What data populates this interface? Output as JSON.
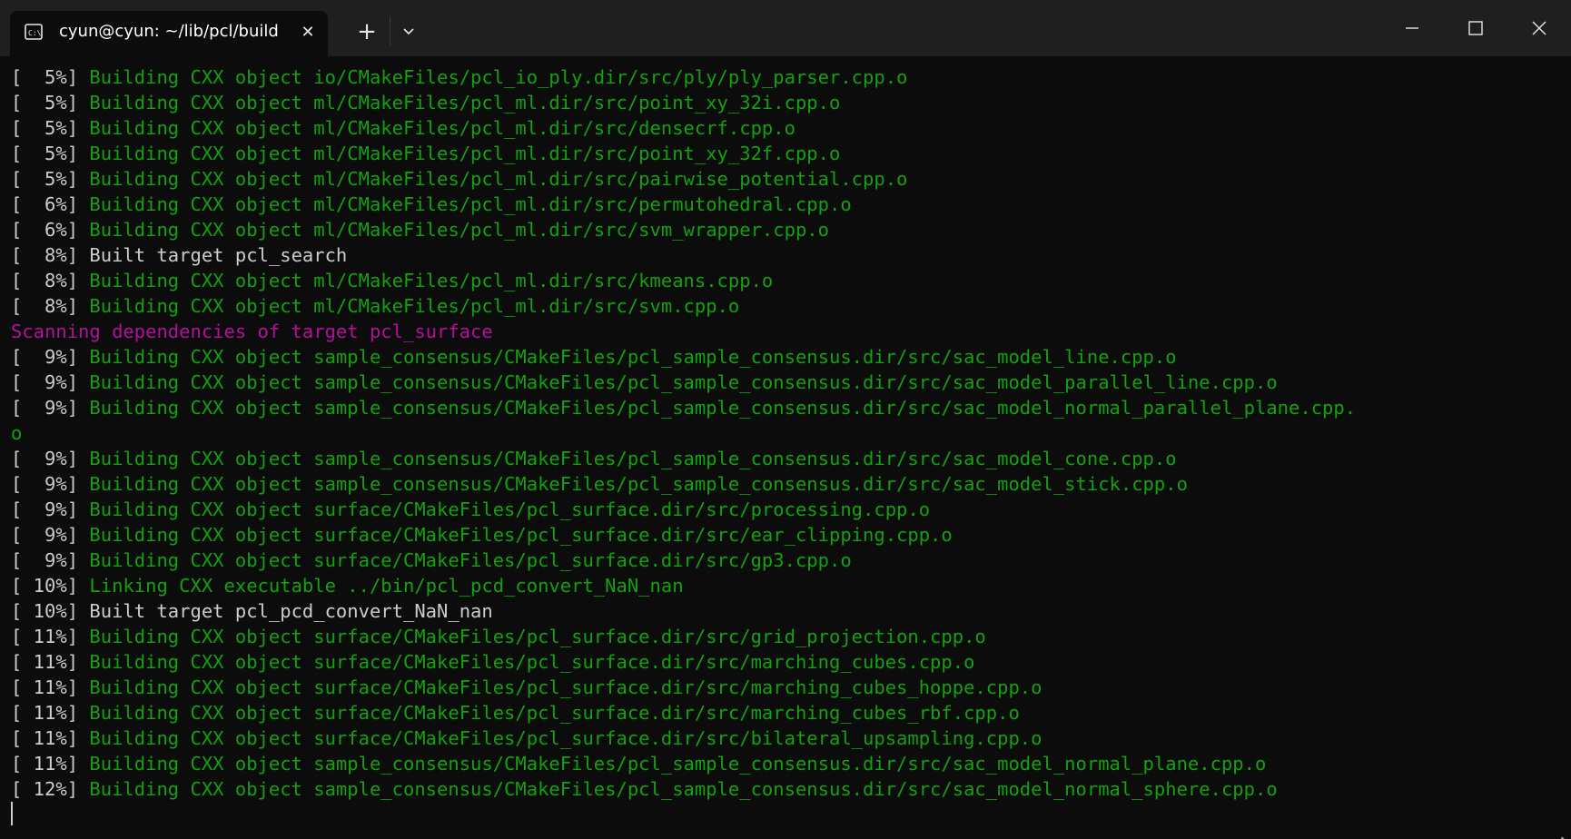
{
  "window": {
    "tab_title": "cyun@cyun: ~/lib/pcl/build",
    "tab_icon": "terminal-icon",
    "new_tab_label": "+",
    "close_tab_label": "✕"
  },
  "colors": {
    "background": "#0c0c0c",
    "titlebar": "#1f1f1f",
    "default_text": "#cccccc",
    "green_text": "#13a10e",
    "magenta_text": "#b3109c"
  },
  "terminal": {
    "lines": [
      {
        "prefix": "[  5%] ",
        "text": "Building CXX object io/CMakeFiles/pcl_io_ply.dir/src/ply/ply_parser.cpp.o",
        "color": "green"
      },
      {
        "prefix": "[  5%] ",
        "text": "Building CXX object ml/CMakeFiles/pcl_ml.dir/src/point_xy_32i.cpp.o",
        "color": "green"
      },
      {
        "prefix": "[  5%] ",
        "text": "Building CXX object ml/CMakeFiles/pcl_ml.dir/src/densecrf.cpp.o",
        "color": "green"
      },
      {
        "prefix": "[  5%] ",
        "text": "Building CXX object ml/CMakeFiles/pcl_ml.dir/src/point_xy_32f.cpp.o",
        "color": "green"
      },
      {
        "prefix": "[  5%] ",
        "text": "Building CXX object ml/CMakeFiles/pcl_ml.dir/src/pairwise_potential.cpp.o",
        "color": "green"
      },
      {
        "prefix": "[  6%] ",
        "text": "Building CXX object ml/CMakeFiles/pcl_ml.dir/src/permutohedral.cpp.o",
        "color": "green"
      },
      {
        "prefix": "[  6%] ",
        "text": "Building CXX object ml/CMakeFiles/pcl_ml.dir/src/svm_wrapper.cpp.o",
        "color": "green"
      },
      {
        "prefix": "[  8%] ",
        "text": "Built target pcl_search",
        "color": "white"
      },
      {
        "prefix": "[  8%] ",
        "text": "Building CXX object ml/CMakeFiles/pcl_ml.dir/src/kmeans.cpp.o",
        "color": "green"
      },
      {
        "prefix": "[  8%] ",
        "text": "Building CXX object ml/CMakeFiles/pcl_ml.dir/src/svm.cpp.o",
        "color": "green"
      },
      {
        "prefix": "",
        "text": "Scanning dependencies of target pcl_surface",
        "color": "magenta"
      },
      {
        "prefix": "[  9%] ",
        "text": "Building CXX object sample_consensus/CMakeFiles/pcl_sample_consensus.dir/src/sac_model_line.cpp.o",
        "color": "green"
      },
      {
        "prefix": "[  9%] ",
        "text": "Building CXX object sample_consensus/CMakeFiles/pcl_sample_consensus.dir/src/sac_model_parallel_line.cpp.o",
        "color": "green"
      },
      {
        "prefix": "[  9%] ",
        "text": "Building CXX object sample_consensus/CMakeFiles/pcl_sample_consensus.dir/src/sac_model_normal_parallel_plane.cpp.",
        "color": "green"
      },
      {
        "prefix": "",
        "text": "o",
        "color": "green"
      },
      {
        "prefix": "[  9%] ",
        "text": "Building CXX object sample_consensus/CMakeFiles/pcl_sample_consensus.dir/src/sac_model_cone.cpp.o",
        "color": "green"
      },
      {
        "prefix": "[  9%] ",
        "text": "Building CXX object sample_consensus/CMakeFiles/pcl_sample_consensus.dir/src/sac_model_stick.cpp.o",
        "color": "green"
      },
      {
        "prefix": "[  9%] ",
        "text": "Building CXX object surface/CMakeFiles/pcl_surface.dir/src/processing.cpp.o",
        "color": "green"
      },
      {
        "prefix": "[  9%] ",
        "text": "Building CXX object surface/CMakeFiles/pcl_surface.dir/src/ear_clipping.cpp.o",
        "color": "green"
      },
      {
        "prefix": "[  9%] ",
        "text": "Building CXX object surface/CMakeFiles/pcl_surface.dir/src/gp3.cpp.o",
        "color": "green"
      },
      {
        "prefix": "[ 10%] ",
        "text": "Linking CXX executable ../bin/pcl_pcd_convert_NaN_nan",
        "color": "bright-green"
      },
      {
        "prefix": "[ 10%] ",
        "text": "Built target pcl_pcd_convert_NaN_nan",
        "color": "white"
      },
      {
        "prefix": "[ 11%] ",
        "text": "Building CXX object surface/CMakeFiles/pcl_surface.dir/src/grid_projection.cpp.o",
        "color": "green"
      },
      {
        "prefix": "[ 11%] ",
        "text": "Building CXX object surface/CMakeFiles/pcl_surface.dir/src/marching_cubes.cpp.o",
        "color": "green"
      },
      {
        "prefix": "[ 11%] ",
        "text": "Building CXX object surface/CMakeFiles/pcl_surface.dir/src/marching_cubes_hoppe.cpp.o",
        "color": "green"
      },
      {
        "prefix": "[ 11%] ",
        "text": "Building CXX object surface/CMakeFiles/pcl_surface.dir/src/marching_cubes_rbf.cpp.o",
        "color": "green"
      },
      {
        "prefix": "[ 11%] ",
        "text": "Building CXX object surface/CMakeFiles/pcl_surface.dir/src/bilateral_upsampling.cpp.o",
        "color": "green"
      },
      {
        "prefix": "[ 11%] ",
        "text": "Building CXX object sample_consensus/CMakeFiles/pcl_sample_consensus.dir/src/sac_model_normal_plane.cpp.o",
        "color": "green"
      },
      {
        "prefix": "[ 12%] ",
        "text": "Building CXX object sample_consensus/CMakeFiles/pcl_sample_consensus.dir/src/sac_model_normal_sphere.cpp.o",
        "color": "green"
      }
    ]
  }
}
